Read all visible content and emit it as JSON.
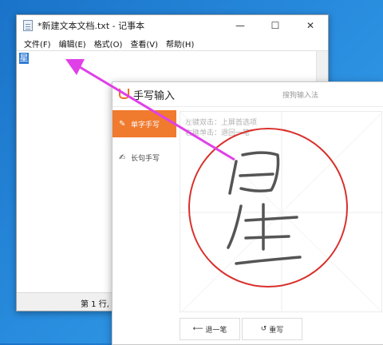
{
  "notepad": {
    "title": "*新建文本文档.txt - 记事本",
    "minimize": "—",
    "maximize": "☐",
    "close": "✕",
    "menu": [
      "文件(F)",
      "编辑(E)",
      "格式(O)",
      "查看(V)",
      "帮助(H)"
    ],
    "content": "星",
    "status": "第 1 行, 第"
  },
  "handwriting": {
    "title": "手写输入",
    "link": "搜狗输入法",
    "modes": [
      {
        "label": "单字手写",
        "icon": "pen-icon"
      },
      {
        "label": "长句手写",
        "icon": "multi-pen-icon"
      }
    ],
    "hints": [
      "左键双击：上屏首选项",
      "右键单击：退回一笔"
    ],
    "buttons": {
      "undo": "退一笔",
      "rewrite": "重写"
    },
    "accent_color": "#f07a2e"
  },
  "annotation": {
    "color": "#e040e8",
    "circle_color": "#d9302c"
  }
}
